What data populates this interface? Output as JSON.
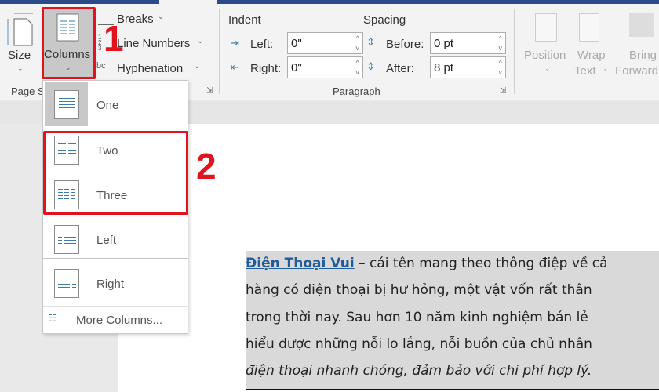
{
  "ribbon": {
    "size_label": "Size",
    "columns_label": "Columns",
    "breaks_label": "Breaks",
    "line_numbers_label": "Line Numbers",
    "hyphenation_label": "Hyphenation",
    "page_setup_group": "Page S",
    "indent_label": "Indent",
    "spacing_label": "Spacing",
    "left_label": "Left:",
    "right_label": "Right:",
    "left_value": "0\"",
    "right_value": "0\"",
    "before_label": "Before:",
    "after_label": "After:",
    "before_value": "0 pt",
    "after_value": "8 pt",
    "paragraph_group": "Paragraph",
    "position_label": "Position",
    "wrap_label": "Wrap",
    "text_label": "Text",
    "bring_label": "Bring",
    "forward_label": "Forward"
  },
  "columns_menu": {
    "items": [
      {
        "label": "One",
        "selected": true
      },
      {
        "label": "Two"
      },
      {
        "label": "Three"
      },
      {
        "label": "Left"
      },
      {
        "label": "Right"
      }
    ],
    "more_label": "More Columns..."
  },
  "annotations": {
    "step1": "1",
    "step2": "2",
    "color": "#e0141e"
  },
  "document": {
    "link_text": "Điện Thoại Vui",
    "line1_rest": " – cái tên mang theo thông điệp về cả",
    "line2": "hàng có điện thoại bị hư hỏng, một vật vốn rất thân",
    "line3": "trong thời nay. Sau hơn 10 năm kinh nghiệm bán lẻ",
    "line4": "hiểu được những nỗi lo lắng, nỗi buồn của chủ nhân",
    "line5": "điện thoại nhanh chóng, đảm bảo với chi phí hợp lý."
  }
}
